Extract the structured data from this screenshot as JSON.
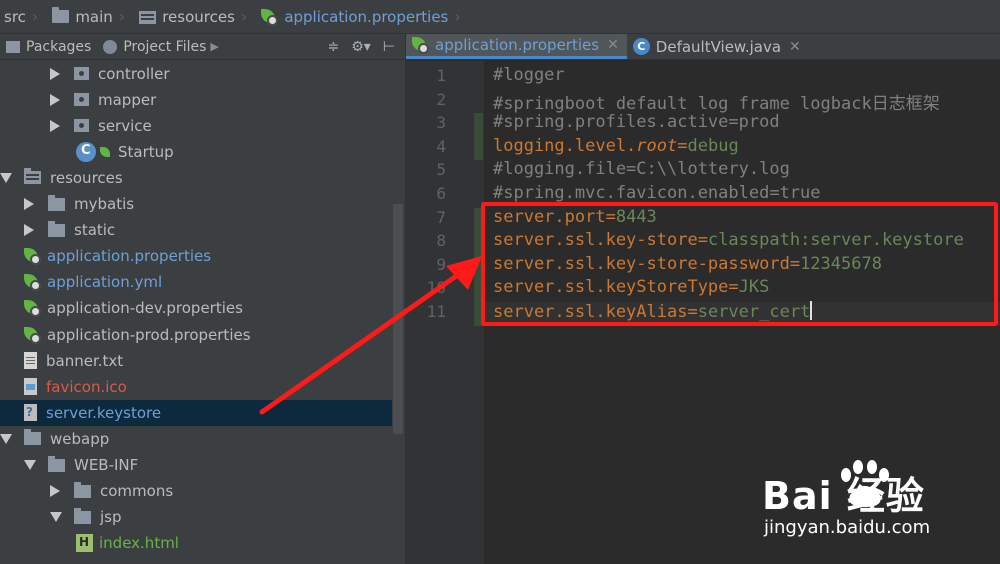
{
  "breadcrumb": {
    "items": [
      "src",
      "main",
      "resources",
      "application.properties"
    ]
  },
  "project_panel": {
    "tabs": [
      "Packages",
      "Project Files"
    ],
    "tree": [
      {
        "label": "controller",
        "kind": "package",
        "expanded": false,
        "color": "default"
      },
      {
        "label": "mapper",
        "kind": "package",
        "expanded": false,
        "color": "default"
      },
      {
        "label": "service",
        "kind": "package",
        "expanded": false,
        "color": "default"
      },
      {
        "label": "Startup",
        "kind": "class",
        "color": "default"
      },
      {
        "label": "resources",
        "kind": "resource-folder",
        "expanded": true,
        "color": "default"
      },
      {
        "label": "mybatis",
        "kind": "folder",
        "expanded": false,
        "color": "default"
      },
      {
        "label": "static",
        "kind": "folder",
        "expanded": false,
        "color": "default"
      },
      {
        "label": "application.properties",
        "kind": "spring-file",
        "color": "blue"
      },
      {
        "label": "application.yml",
        "kind": "spring-file",
        "color": "blue"
      },
      {
        "label": "application-dev.properties",
        "kind": "spring-file",
        "color": "default"
      },
      {
        "label": "application-prod.properties",
        "kind": "spring-file",
        "color": "default"
      },
      {
        "label": "banner.txt",
        "kind": "text-file",
        "color": "default"
      },
      {
        "label": "favicon.ico",
        "kind": "ico-file",
        "color": "red"
      },
      {
        "label": "server.keystore",
        "kind": "keystore-file",
        "color": "blue",
        "selected": true
      },
      {
        "label": "webapp",
        "kind": "folder",
        "expanded": true,
        "color": "default"
      },
      {
        "label": "WEB-INF",
        "kind": "folder",
        "expanded": true,
        "color": "default"
      },
      {
        "label": "commons",
        "kind": "folder",
        "expanded": false,
        "color": "default"
      },
      {
        "label": "jsp",
        "kind": "folder",
        "expanded": true,
        "color": "default"
      },
      {
        "label": "index.html",
        "kind": "html-file",
        "color": "green"
      }
    ]
  },
  "editor": {
    "tabs": [
      {
        "label": "application.properties",
        "active": true
      },
      {
        "label": "DefaultView.java",
        "active": false
      }
    ],
    "lines": [
      {
        "no": "1",
        "text": "#logger"
      },
      {
        "no": "2",
        "text": "#springboot default log frame logback日志框架"
      },
      {
        "no": "3",
        "text": "#spring.profiles.active=prod"
      },
      {
        "no": "4",
        "key": "logging.level.",
        "key_italic": "root",
        "eq": "=",
        "value": "debug"
      },
      {
        "no": "5",
        "text": "#logging.file=C:\\\\lottery.log"
      },
      {
        "no": "6",
        "text": "#spring.mvc.favicon.enabled=true"
      },
      {
        "no": "7",
        "key": "server.port",
        "eq": "=",
        "value": "8443"
      },
      {
        "no": "8",
        "key": "server.ssl.key-store",
        "eq": "=",
        "value": "classpath:server.keystore"
      },
      {
        "no": "9",
        "key": "server.ssl.key-store-password",
        "eq": "=",
        "value": "12345678"
      },
      {
        "no": "10",
        "key": "server.ssl.keyStoreType",
        "eq": "=",
        "value": "JKS"
      },
      {
        "no": "11",
        "key": "server.ssl.keyAlias",
        "eq": "=",
        "value": "server_cert"
      }
    ]
  },
  "watermark": {
    "brand": "Bai 经验",
    "url": "jingyan.baidu.com"
  },
  "colors": {
    "annotation": "#ff1a1a",
    "key": "#cc7832",
    "value": "#6a8759",
    "comment": "#808080"
  }
}
